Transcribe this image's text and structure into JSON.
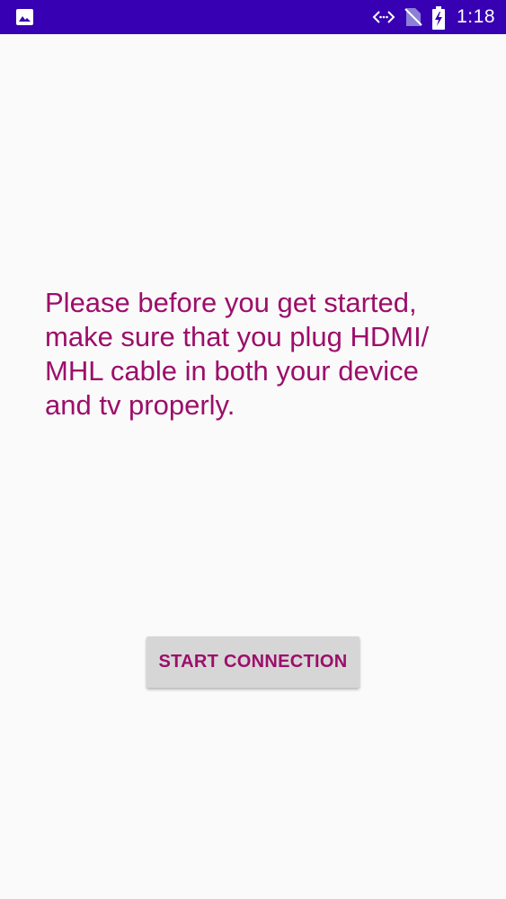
{
  "status_bar": {
    "time": "1:18",
    "icons": [
      "image-icon",
      "data-saver-icon",
      "no-signal-icon",
      "battery-charging-icon"
    ],
    "background_color": "#3700b3"
  },
  "main": {
    "message": "Please before you get started, make sure that you plug HDMI/ MHL cable in both your device and tv properly.",
    "start_button_label": "START CONNECTION",
    "accent_color": "#9c0e6a"
  }
}
